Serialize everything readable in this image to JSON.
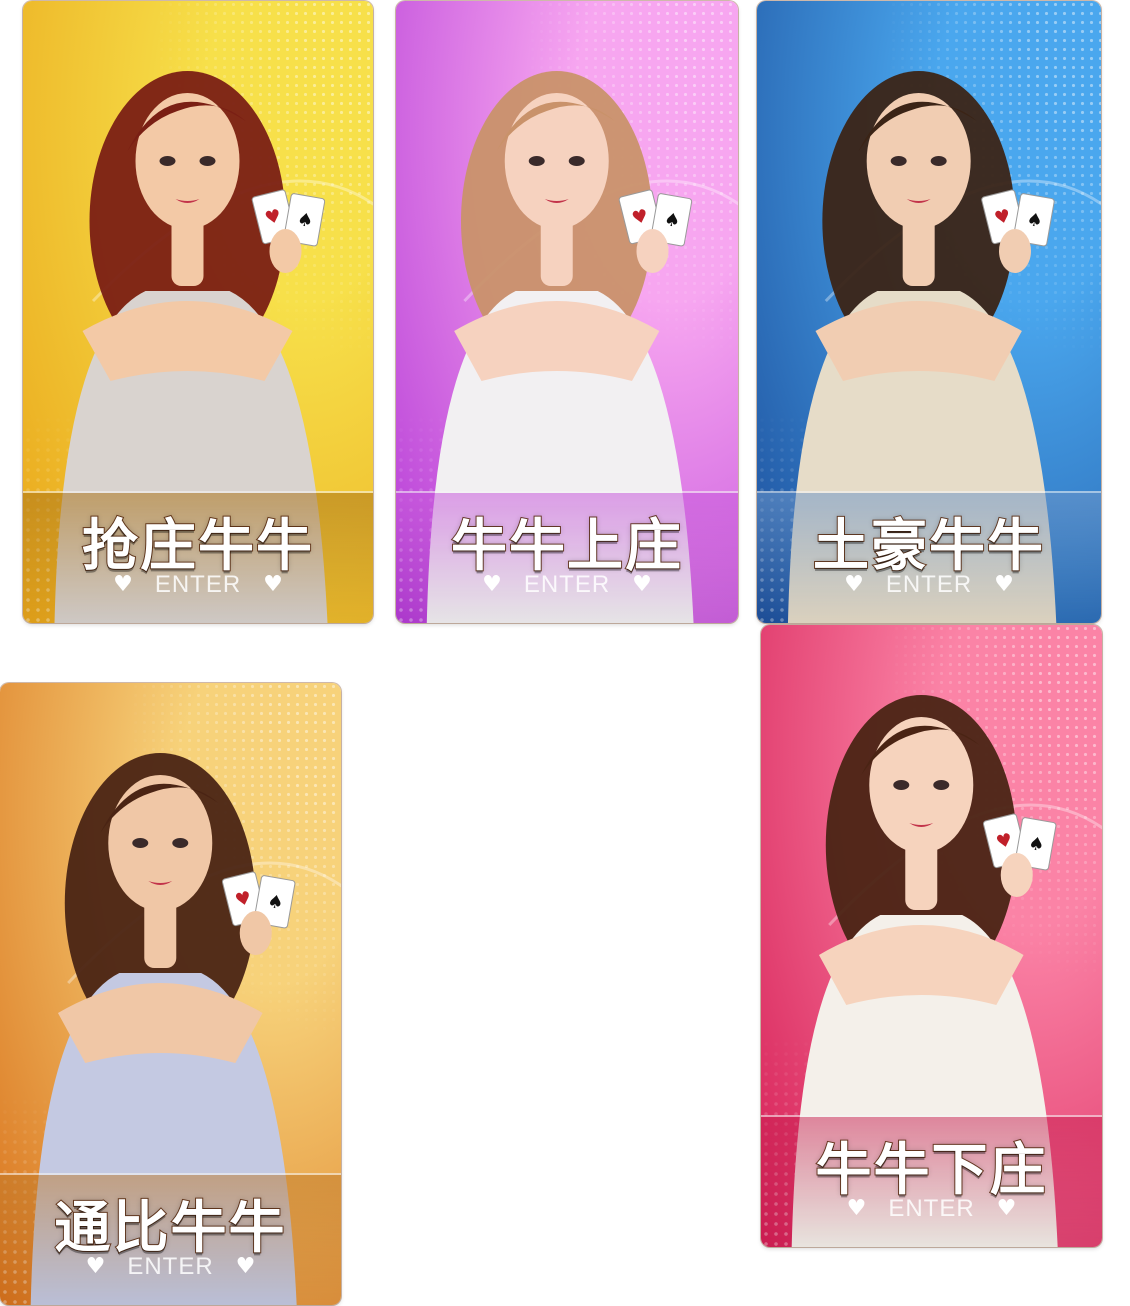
{
  "games": [
    {
      "title": "抢庄牛牛",
      "enter": "ENTER",
      "heart_icon": "heart-icon",
      "colors": {
        "bg1": "#f7e04a",
        "bg2": "#e9a51a",
        "banner": "rgba(170,115,25,0.55)",
        "skin": "#f3c9a6",
        "hair": "#7a1f14",
        "dress": "#d9d3cf"
      }
    },
    {
      "title": "牛牛上庄",
      "enter": "ENTER",
      "heart_icon": "heart-icon",
      "colors": {
        "bg1": "#f7a6f0",
        "bg2": "#b43ad6",
        "banner": "rgba(200,90,220,0.55)",
        "skin": "#f6d2bf",
        "hair": "#c9926a",
        "dress": "#f2f0f2"
      }
    },
    {
      "title": "土豪牛牛",
      "enter": "ENTER",
      "heart_icon": "heart-icon",
      "colors": {
        "bg1": "#4aa7ee",
        "bg2": "#1d4f9c",
        "banner": "rgba(110,150,200,0.55)",
        "skin": "#f1cdb2",
        "hair": "#3b2416",
        "dress": "#e6dcc8"
      }
    },
    {
      "title": "通比牛牛",
      "enter": "ENTER",
      "heart_icon": "heart-icon",
      "colors": {
        "bg1": "#f7d27a",
        "bg2": "#d9721c",
        "banner": "rgba(190,120,40,0.5)",
        "skin": "#f0c7a6",
        "hair": "#4a2414",
        "dress": "#c4c9e2"
      }
    },
    {
      "title": "牛牛下庄",
      "enter": "ENTER",
      "heart_icon": "heart-icon",
      "colors": {
        "bg1": "#fb83a6",
        "bg2": "#d51d54",
        "banner": "rgba(200,30,80,0.5)",
        "skin": "#f6d3bd",
        "hair": "#4a2414",
        "dress": "#f4f0ea"
      }
    }
  ]
}
